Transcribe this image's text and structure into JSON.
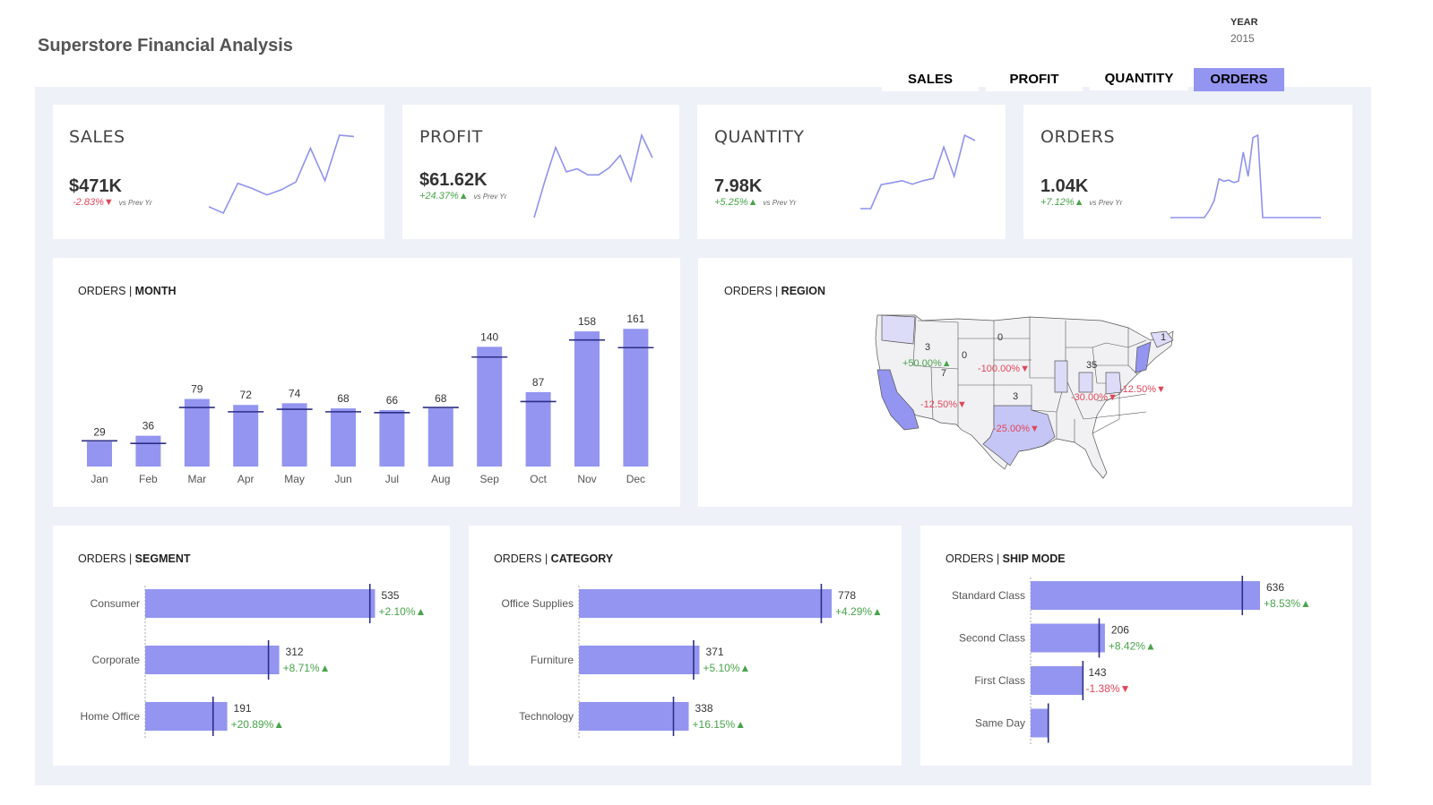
{
  "header": {
    "title": "Superstore Financial Analysis",
    "year_label": "YEAR",
    "year_value": "2015"
  },
  "tabs": [
    {
      "label": "SALES",
      "active": false
    },
    {
      "label": "PROFIT",
      "active": false
    },
    {
      "label": "QUANTITY",
      "active": false
    },
    {
      "label": "ORDERS",
      "active": true
    }
  ],
  "colors": {
    "accent": "#9395f0",
    "line": "#8f92ee",
    "target": "#2d2f86",
    "positive": "#49a34c",
    "negative": "#e0465a",
    "panel_bg": "#eef1f8"
  },
  "kpis": [
    {
      "label": "SALES",
      "value": "$471K",
      "delta": "-2.83%",
      "delta_dir": "down",
      "vs": "vs Prev Yr",
      "spark": [
        3.2,
        2.2,
        6.8,
        6.0,
        5.0,
        5.8,
        7.0,
        12.2,
        7.2,
        14.2,
        14.0
      ]
    },
    {
      "label": "PROFIT",
      "value": "$61.62K",
      "delta": "+24.37%",
      "delta_dir": "up",
      "vs": "vs Prev Yr",
      "spark": [
        0.0,
        6.0,
        11.5,
        7.5,
        8.0,
        7.0,
        7.0,
        8.2,
        10.2,
        6.0,
        13.5,
        9.8
      ]
    },
    {
      "label": "QUANTITY",
      "value": "7.98K",
      "delta": "+5.25%",
      "delta_dir": "up",
      "vs": "vs Prev Yr",
      "spark": [
        0.0,
        0.0,
        5.5,
        5.9,
        6.4,
        5.6,
        6.4,
        6.9,
        14.1,
        7.4,
        16.8,
        15.6
      ]
    },
    {
      "label": "ORDERS",
      "value": "1.04K",
      "delta": "+7.12%",
      "delta_dir": "up",
      "vs": "vs Prev Yr",
      "spark": [
        0,
        0,
        0,
        0,
        0,
        0,
        0,
        0,
        3,
        7,
        16,
        15,
        15.5,
        14.5,
        15,
        27,
        17,
        33,
        34,
        0,
        0,
        0,
        0,
        0,
        0,
        0,
        0,
        0,
        0,
        0,
        0,
        0
      ]
    }
  ],
  "month_chart": {
    "title_prefix": "ORDERS | ",
    "title_bold": "MONTH"
  },
  "region_chart": {
    "title_prefix": "ORDERS | ",
    "title_bold": "REGION",
    "labels": [
      {
        "text": "3"
      },
      {
        "text": "0"
      },
      {
        "text": "0"
      },
      {
        "text": "35"
      },
      {
        "text": "1"
      },
      {
        "text": "7"
      },
      {
        "text": "3"
      }
    ],
    "deltas": [
      {
        "text": "+50.00%",
        "dir": "up"
      },
      {
        "text": "-100.00%",
        "dir": "down"
      },
      {
        "text": "-12.50%",
        "dir": "down"
      },
      {
        "text": "-30.00%",
        "dir": "down"
      },
      {
        "text": "-12.50%",
        "dir": "down"
      },
      {
        "text": "-25.00%",
        "dir": "down"
      }
    ]
  },
  "segment_chart": {
    "title_prefix": "ORDERS | ",
    "title_bold": "SEGMENT"
  },
  "category_chart": {
    "title_prefix": "ORDERS | ",
    "title_bold": "CATEGORY"
  },
  "shipmode_chart": {
    "title_prefix": "ORDERS | ",
    "title_bold": "SHIP MODE"
  },
  "chart_data": [
    {
      "type": "bar",
      "name": "ORDERS | MONTH",
      "categories": [
        "Jan",
        "Feb",
        "Mar",
        "Apr",
        "May",
        "Jun",
        "Jul",
        "Aug",
        "Sep",
        "Oct",
        "Nov",
        "Dec"
      ],
      "values": [
        29,
        36,
        79,
        72,
        74,
        68,
        66,
        68,
        140,
        87,
        158,
        161
      ],
      "reference_values": [
        30,
        27,
        69,
        64,
        67,
        64,
        63,
        69,
        128,
        76,
        148,
        139
      ],
      "ylim": [
        0,
        175
      ]
    },
    {
      "type": "bar",
      "orientation": "horizontal",
      "name": "ORDERS | SEGMENT",
      "categories": [
        "Consumer",
        "Corporate",
        "Home Office"
      ],
      "values": [
        535,
        312,
        191
      ],
      "reference_values": [
        523,
        287,
        158
      ],
      "labels": [
        "+2.10%",
        "+8.71%",
        "+20.89%"
      ],
      "label_dirs": [
        "up",
        "up",
        "up"
      ],
      "xlim": [
        0,
        560
      ]
    },
    {
      "type": "bar",
      "orientation": "horizontal",
      "name": "ORDERS | CATEGORY",
      "categories": [
        "Office Supplies",
        "Furniture",
        "Technology"
      ],
      "values": [
        778,
        371,
        338
      ],
      "reference_values": [
        746,
        353,
        291
      ],
      "labels": [
        "+4.29%",
        "+5.10%",
        "+16.15%"
      ],
      "label_dirs": [
        "up",
        "up",
        "up"
      ],
      "xlim": [
        0,
        800
      ]
    },
    {
      "type": "bar",
      "orientation": "horizontal",
      "name": "ORDERS | SHIP MODE",
      "categories": [
        "Standard Class",
        "Second Class",
        "First Class",
        "Same Day"
      ],
      "values": [
        636,
        206,
        143,
        null
      ],
      "value_labels": [
        "636",
        "206",
        "143",
        ""
      ],
      "reference_values": [
        587,
        190,
        145,
        49
      ],
      "bar_values": [
        636,
        206,
        143,
        49
      ],
      "labels": [
        "+8.53%",
        "+8.42%",
        "-1.38%",
        ""
      ],
      "label_dirs": [
        "up",
        "up",
        "down",
        ""
      ],
      "xlim": [
        0,
        650
      ]
    }
  ]
}
